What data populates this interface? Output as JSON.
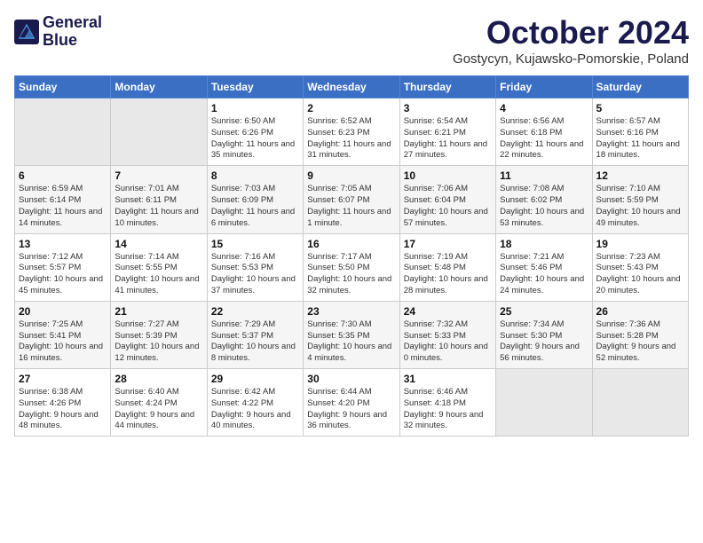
{
  "logo": {
    "line1": "General",
    "line2": "Blue"
  },
  "title": "October 2024",
  "location": "Gostycyn, Kujawsko-Pomorskie, Poland",
  "days_of_week": [
    "Sunday",
    "Monday",
    "Tuesday",
    "Wednesday",
    "Thursday",
    "Friday",
    "Saturday"
  ],
  "weeks": [
    [
      {
        "day": "",
        "info": ""
      },
      {
        "day": "",
        "info": ""
      },
      {
        "day": "1",
        "info": "Sunrise: 6:50 AM\nSunset: 6:26 PM\nDaylight: 11 hours and 35 minutes."
      },
      {
        "day": "2",
        "info": "Sunrise: 6:52 AM\nSunset: 6:23 PM\nDaylight: 11 hours and 31 minutes."
      },
      {
        "day": "3",
        "info": "Sunrise: 6:54 AM\nSunset: 6:21 PM\nDaylight: 11 hours and 27 minutes."
      },
      {
        "day": "4",
        "info": "Sunrise: 6:56 AM\nSunset: 6:18 PM\nDaylight: 11 hours and 22 minutes."
      },
      {
        "day": "5",
        "info": "Sunrise: 6:57 AM\nSunset: 6:16 PM\nDaylight: 11 hours and 18 minutes."
      }
    ],
    [
      {
        "day": "6",
        "info": "Sunrise: 6:59 AM\nSunset: 6:14 PM\nDaylight: 11 hours and 14 minutes."
      },
      {
        "day": "7",
        "info": "Sunrise: 7:01 AM\nSunset: 6:11 PM\nDaylight: 11 hours and 10 minutes."
      },
      {
        "day": "8",
        "info": "Sunrise: 7:03 AM\nSunset: 6:09 PM\nDaylight: 11 hours and 6 minutes."
      },
      {
        "day": "9",
        "info": "Sunrise: 7:05 AM\nSunset: 6:07 PM\nDaylight: 11 hours and 1 minute."
      },
      {
        "day": "10",
        "info": "Sunrise: 7:06 AM\nSunset: 6:04 PM\nDaylight: 10 hours and 57 minutes."
      },
      {
        "day": "11",
        "info": "Sunrise: 7:08 AM\nSunset: 6:02 PM\nDaylight: 10 hours and 53 minutes."
      },
      {
        "day": "12",
        "info": "Sunrise: 7:10 AM\nSunset: 5:59 PM\nDaylight: 10 hours and 49 minutes."
      }
    ],
    [
      {
        "day": "13",
        "info": "Sunrise: 7:12 AM\nSunset: 5:57 PM\nDaylight: 10 hours and 45 minutes."
      },
      {
        "day": "14",
        "info": "Sunrise: 7:14 AM\nSunset: 5:55 PM\nDaylight: 10 hours and 41 minutes."
      },
      {
        "day": "15",
        "info": "Sunrise: 7:16 AM\nSunset: 5:53 PM\nDaylight: 10 hours and 37 minutes."
      },
      {
        "day": "16",
        "info": "Sunrise: 7:17 AM\nSunset: 5:50 PM\nDaylight: 10 hours and 32 minutes."
      },
      {
        "day": "17",
        "info": "Sunrise: 7:19 AM\nSunset: 5:48 PM\nDaylight: 10 hours and 28 minutes."
      },
      {
        "day": "18",
        "info": "Sunrise: 7:21 AM\nSunset: 5:46 PM\nDaylight: 10 hours and 24 minutes."
      },
      {
        "day": "19",
        "info": "Sunrise: 7:23 AM\nSunset: 5:43 PM\nDaylight: 10 hours and 20 minutes."
      }
    ],
    [
      {
        "day": "20",
        "info": "Sunrise: 7:25 AM\nSunset: 5:41 PM\nDaylight: 10 hours and 16 minutes."
      },
      {
        "day": "21",
        "info": "Sunrise: 7:27 AM\nSunset: 5:39 PM\nDaylight: 10 hours and 12 minutes."
      },
      {
        "day": "22",
        "info": "Sunrise: 7:29 AM\nSunset: 5:37 PM\nDaylight: 10 hours and 8 minutes."
      },
      {
        "day": "23",
        "info": "Sunrise: 7:30 AM\nSunset: 5:35 PM\nDaylight: 10 hours and 4 minutes."
      },
      {
        "day": "24",
        "info": "Sunrise: 7:32 AM\nSunset: 5:33 PM\nDaylight: 10 hours and 0 minutes."
      },
      {
        "day": "25",
        "info": "Sunrise: 7:34 AM\nSunset: 5:30 PM\nDaylight: 9 hours and 56 minutes."
      },
      {
        "day": "26",
        "info": "Sunrise: 7:36 AM\nSunset: 5:28 PM\nDaylight: 9 hours and 52 minutes."
      }
    ],
    [
      {
        "day": "27",
        "info": "Sunrise: 6:38 AM\nSunset: 4:26 PM\nDaylight: 9 hours and 48 minutes."
      },
      {
        "day": "28",
        "info": "Sunrise: 6:40 AM\nSunset: 4:24 PM\nDaylight: 9 hours and 44 minutes."
      },
      {
        "day": "29",
        "info": "Sunrise: 6:42 AM\nSunset: 4:22 PM\nDaylight: 9 hours and 40 minutes."
      },
      {
        "day": "30",
        "info": "Sunrise: 6:44 AM\nSunset: 4:20 PM\nDaylight: 9 hours and 36 minutes."
      },
      {
        "day": "31",
        "info": "Sunrise: 6:46 AM\nSunset: 4:18 PM\nDaylight: 9 hours and 32 minutes."
      },
      {
        "day": "",
        "info": ""
      },
      {
        "day": "",
        "info": ""
      }
    ]
  ]
}
